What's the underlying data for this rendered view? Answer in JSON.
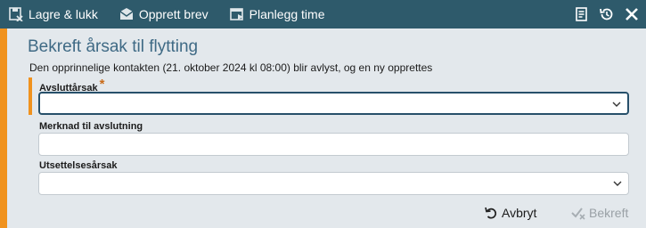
{
  "toolbar": {
    "save_close_label": "Lagre & lukk",
    "create_letter_label": "Opprett brev",
    "schedule_label": "Planlegg time"
  },
  "dialog": {
    "title": "Bekreft årsak til flytting",
    "description": "Den opprinnelige kontakten (21. oktober 2024 kl 08:00) blir avlyst, og en ny opprettes",
    "fields": {
      "end_reason": {
        "label": "Avsluttårsak",
        "required_marker": "*",
        "value": ""
      },
      "end_note": {
        "label": "Merknad til avslutning",
        "value": ""
      },
      "postpone_reason": {
        "label": "Utsettelsesårsak",
        "value": ""
      }
    },
    "buttons": {
      "cancel_label": "Avbryt",
      "confirm_label": "Bekreft"
    }
  },
  "colors": {
    "toolbar_bg": "#2e5a6b",
    "accent": "#f0921e",
    "title": "#3f6a85",
    "active_border": "#27506a",
    "disabled_text": "#9aa1a6"
  }
}
